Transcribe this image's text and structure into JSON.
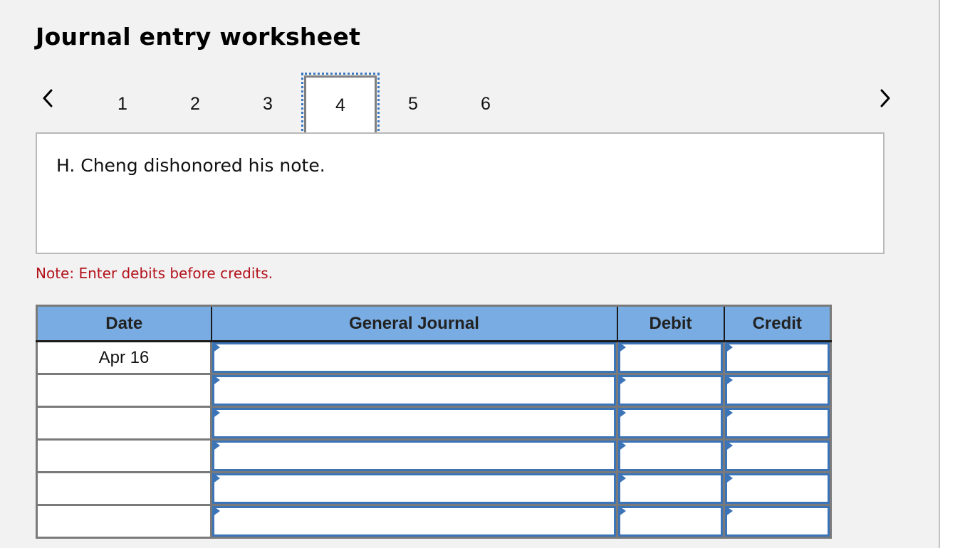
{
  "title": "Journal entry worksheet",
  "navigation": {
    "prev_icon": "chevron-left-icon",
    "next_icon": "chevron-right-icon",
    "tabs": [
      {
        "label": "1",
        "active": false
      },
      {
        "label": "2",
        "active": false
      },
      {
        "label": "3",
        "active": false
      },
      {
        "label": "4",
        "active": true
      },
      {
        "label": "5",
        "active": false
      },
      {
        "label": "6",
        "active": false
      }
    ]
  },
  "description": "H. Cheng dishonored his note.",
  "note": "Note: Enter debits before credits.",
  "colors": {
    "header_bg": "#78ace2",
    "input_border": "#3c74b8",
    "note_text": "#b3121c",
    "focus_outline": "#3a78c0"
  },
  "journal": {
    "columns": [
      "Date",
      "General Journal",
      "Debit",
      "Credit"
    ],
    "rows": [
      {
        "date": "Apr 16",
        "account": "",
        "debit": "",
        "credit": ""
      },
      {
        "date": "",
        "account": "",
        "debit": "",
        "credit": ""
      },
      {
        "date": "",
        "account": "",
        "debit": "",
        "credit": ""
      },
      {
        "date": "",
        "account": "",
        "debit": "",
        "credit": ""
      },
      {
        "date": "",
        "account": "",
        "debit": "",
        "credit": ""
      },
      {
        "date": "",
        "account": "",
        "debit": "",
        "credit": ""
      }
    ]
  }
}
